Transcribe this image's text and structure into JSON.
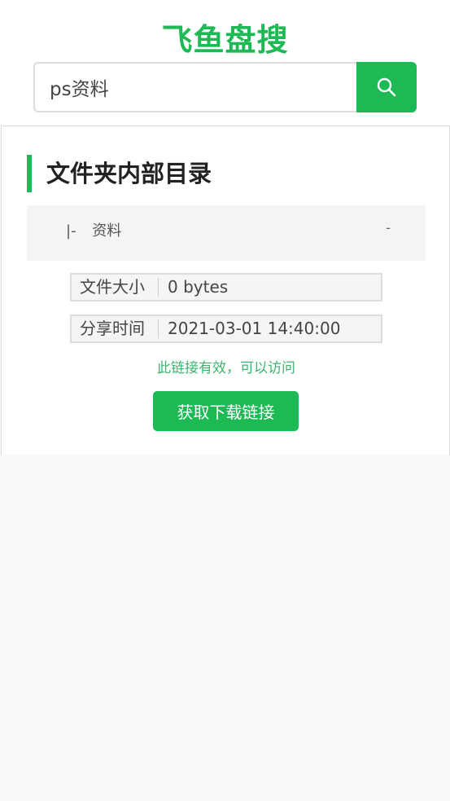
{
  "header": {
    "logo": "飞鱼盘搜",
    "search_value": "ps资料",
    "search_icon": "search-icon"
  },
  "folder": {
    "title": "文件夹内部目录",
    "items": [
      {
        "branch": "|-",
        "name": "资料",
        "size": "-"
      }
    ]
  },
  "info": {
    "size_label": "文件大小",
    "size_value": "0 bytes",
    "time_label": "分享时间",
    "time_value": "2021-03-01 14:40:00"
  },
  "status_text": "此链接有效，可以访问",
  "download_label": "获取下载链接",
  "colors": {
    "brand": "#1db954",
    "status": "#3db46d"
  }
}
